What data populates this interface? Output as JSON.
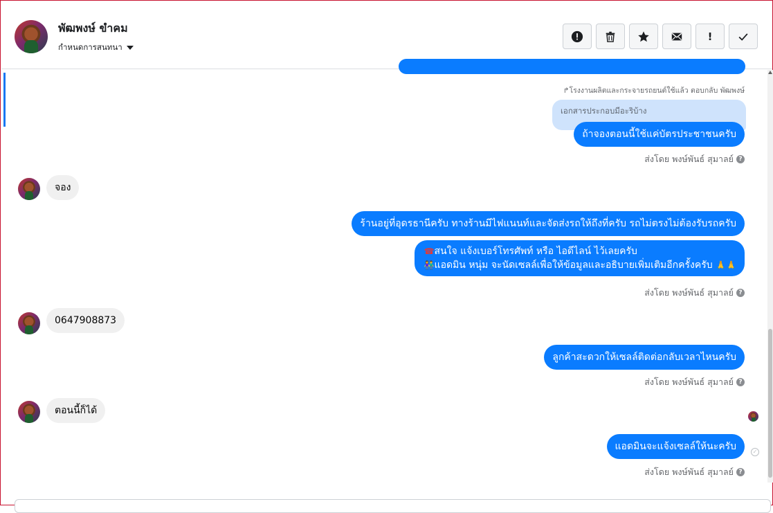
{
  "contact": {
    "name": "พัฒพงษ์ ขำคม",
    "settings_label": "กำหนดการสนทนา"
  },
  "toolbar": [
    {
      "name": "report-icon"
    },
    {
      "name": "trash-icon"
    },
    {
      "name": "star-icon"
    },
    {
      "name": "mail-icon"
    },
    {
      "name": "exclamation-icon",
      "glyph": "!"
    },
    {
      "name": "check-icon"
    }
  ],
  "thread": {
    "reply_reference": "↱โรงงานผลิตและกระจายรถยนต์ใช้แล้ว ตอบกลับ พัฒพงษ์",
    "quoted_text": "เอกสารประกอบมีอะริบ้าง",
    "sent_by": "ส่งโดย พงษ์พันธ์ สุมาลย์",
    "help_glyph": "?",
    "messages": [
      {
        "from": "page",
        "text": "ถ้าจองตอนนี้ใช้แค่บัตรประชาชนครับ"
      },
      {
        "from": "customer",
        "text": "จอง"
      },
      {
        "from": "page",
        "text": "ร้านอยู่ที่อุดรธานีครับ ทางร้านมีไฟแนนท์และจัดส่งรถให้ถึงที่ครับ รถไม่ตรงไม่ต้องรับรถครับ"
      },
      {
        "from": "page",
        "line1_emoji": "☎",
        "line1": "สนใจ แจ้งเบอร์โทรศัพท์ หรือ ไอดีไลน์  ไว้เลยครับ",
        "line2_emoji": "👫",
        "line2": "แอดมิน หนุ่ม จะนัดเซลล์เพื่อให้ข้อมูลและอธิบายเพิ่มเติมอีกครั้งครับ",
        "line2_end": "🙏🙏"
      },
      {
        "from": "customer",
        "text": "0647908873"
      },
      {
        "from": "page",
        "text": "ลูกค้าสะดวกให้เซลล์ติดต่อกลับเวลาไหนครับ"
      },
      {
        "from": "customer",
        "text": "ตอนนี้ก็ได้"
      },
      {
        "from": "page",
        "text": "แอดมินจะแจ้งเซลล์ให้นะครับ"
      }
    ],
    "sent_glyph": "✓"
  },
  "colors": {
    "outgoing_bubble": "#0a7cff",
    "incoming_bubble": "#f0f0f0",
    "quoted_bubble": "#cfe3fc"
  }
}
